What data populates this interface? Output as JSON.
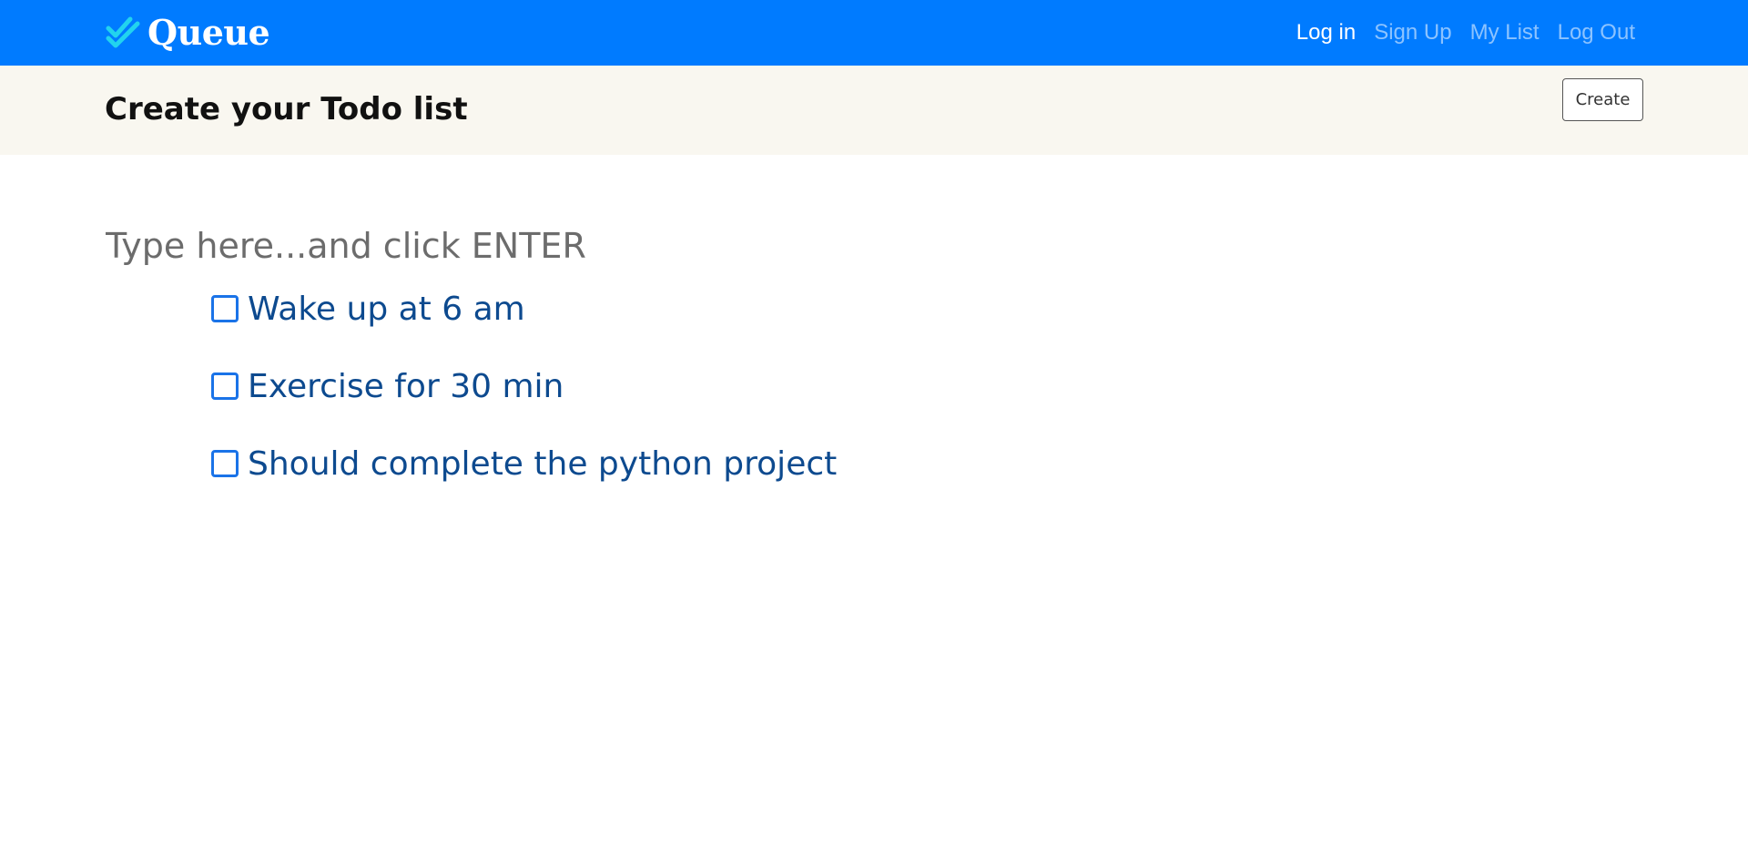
{
  "navbar": {
    "brand": {
      "name": "Queue",
      "icon": "double-check-icon"
    },
    "links": [
      {
        "label": "Log in",
        "active": true
      },
      {
        "label": "Sign Up",
        "active": false
      },
      {
        "label": "My List",
        "active": false
      },
      {
        "label": "Log Out",
        "active": false
      }
    ]
  },
  "subheader": {
    "title": "Create your Todo list",
    "create_label": "Create"
  },
  "todo": {
    "placeholder": "Type here...and click ENTER",
    "value": "",
    "items": [
      {
        "text": "Wake up at 6 am",
        "checked": false
      },
      {
        "text": "Exercise for 30 min",
        "checked": false
      },
      {
        "text": "Should complete the python project",
        "checked": false
      }
    ]
  },
  "colors": {
    "navbar_bg": "#007bff",
    "subheader_bg": "#f9f7f0",
    "brand_icon": "#22d3ee",
    "todo_text": "#0d4a8f",
    "checkbox_border": "#1a73e8"
  }
}
